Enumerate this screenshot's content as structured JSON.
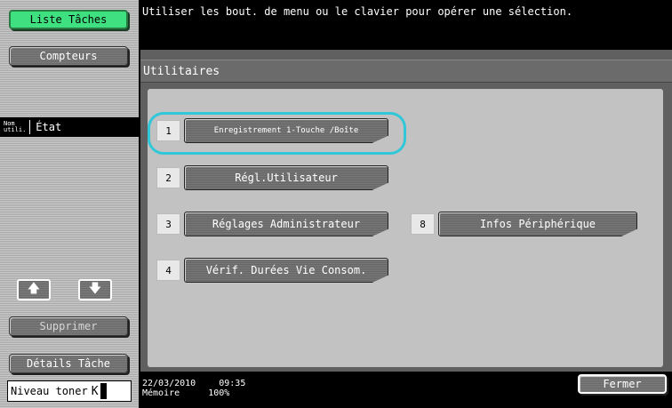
{
  "sidebar": {
    "job_list": "Liste Tâches",
    "counters": "Compteurs",
    "col_user": "Nom\nutili.",
    "col_state": "État",
    "delete": "Supprimer",
    "job_details": "Détails Tâche",
    "toner_label": "Niveau toner",
    "toner_k": "K"
  },
  "header": {
    "message": "Utiliser les bout. de menu ou le clavier pour opérer une sélection."
  },
  "panel": {
    "title": "Utilitaires",
    "items": [
      {
        "num": "1",
        "label": "Enregistrement 1-Touche /Boîte"
      },
      {
        "num": "2",
        "label": "Régl.Utilisateur"
      },
      {
        "num": "3",
        "label": "Réglages Administrateur"
      },
      {
        "num": "8",
        "label": "Infos Périphérique"
      },
      {
        "num": "4",
        "label": "Vérif. Durées Vie Consom."
      }
    ]
  },
  "status": {
    "date": "22/03/2010",
    "time": "09:35",
    "memory_label": "Mémoire",
    "memory_value": "100%"
  },
  "close": "Fermer",
  "colors": {
    "accent_green": "#3fe07f",
    "selection_ring": "#30c8d8"
  }
}
